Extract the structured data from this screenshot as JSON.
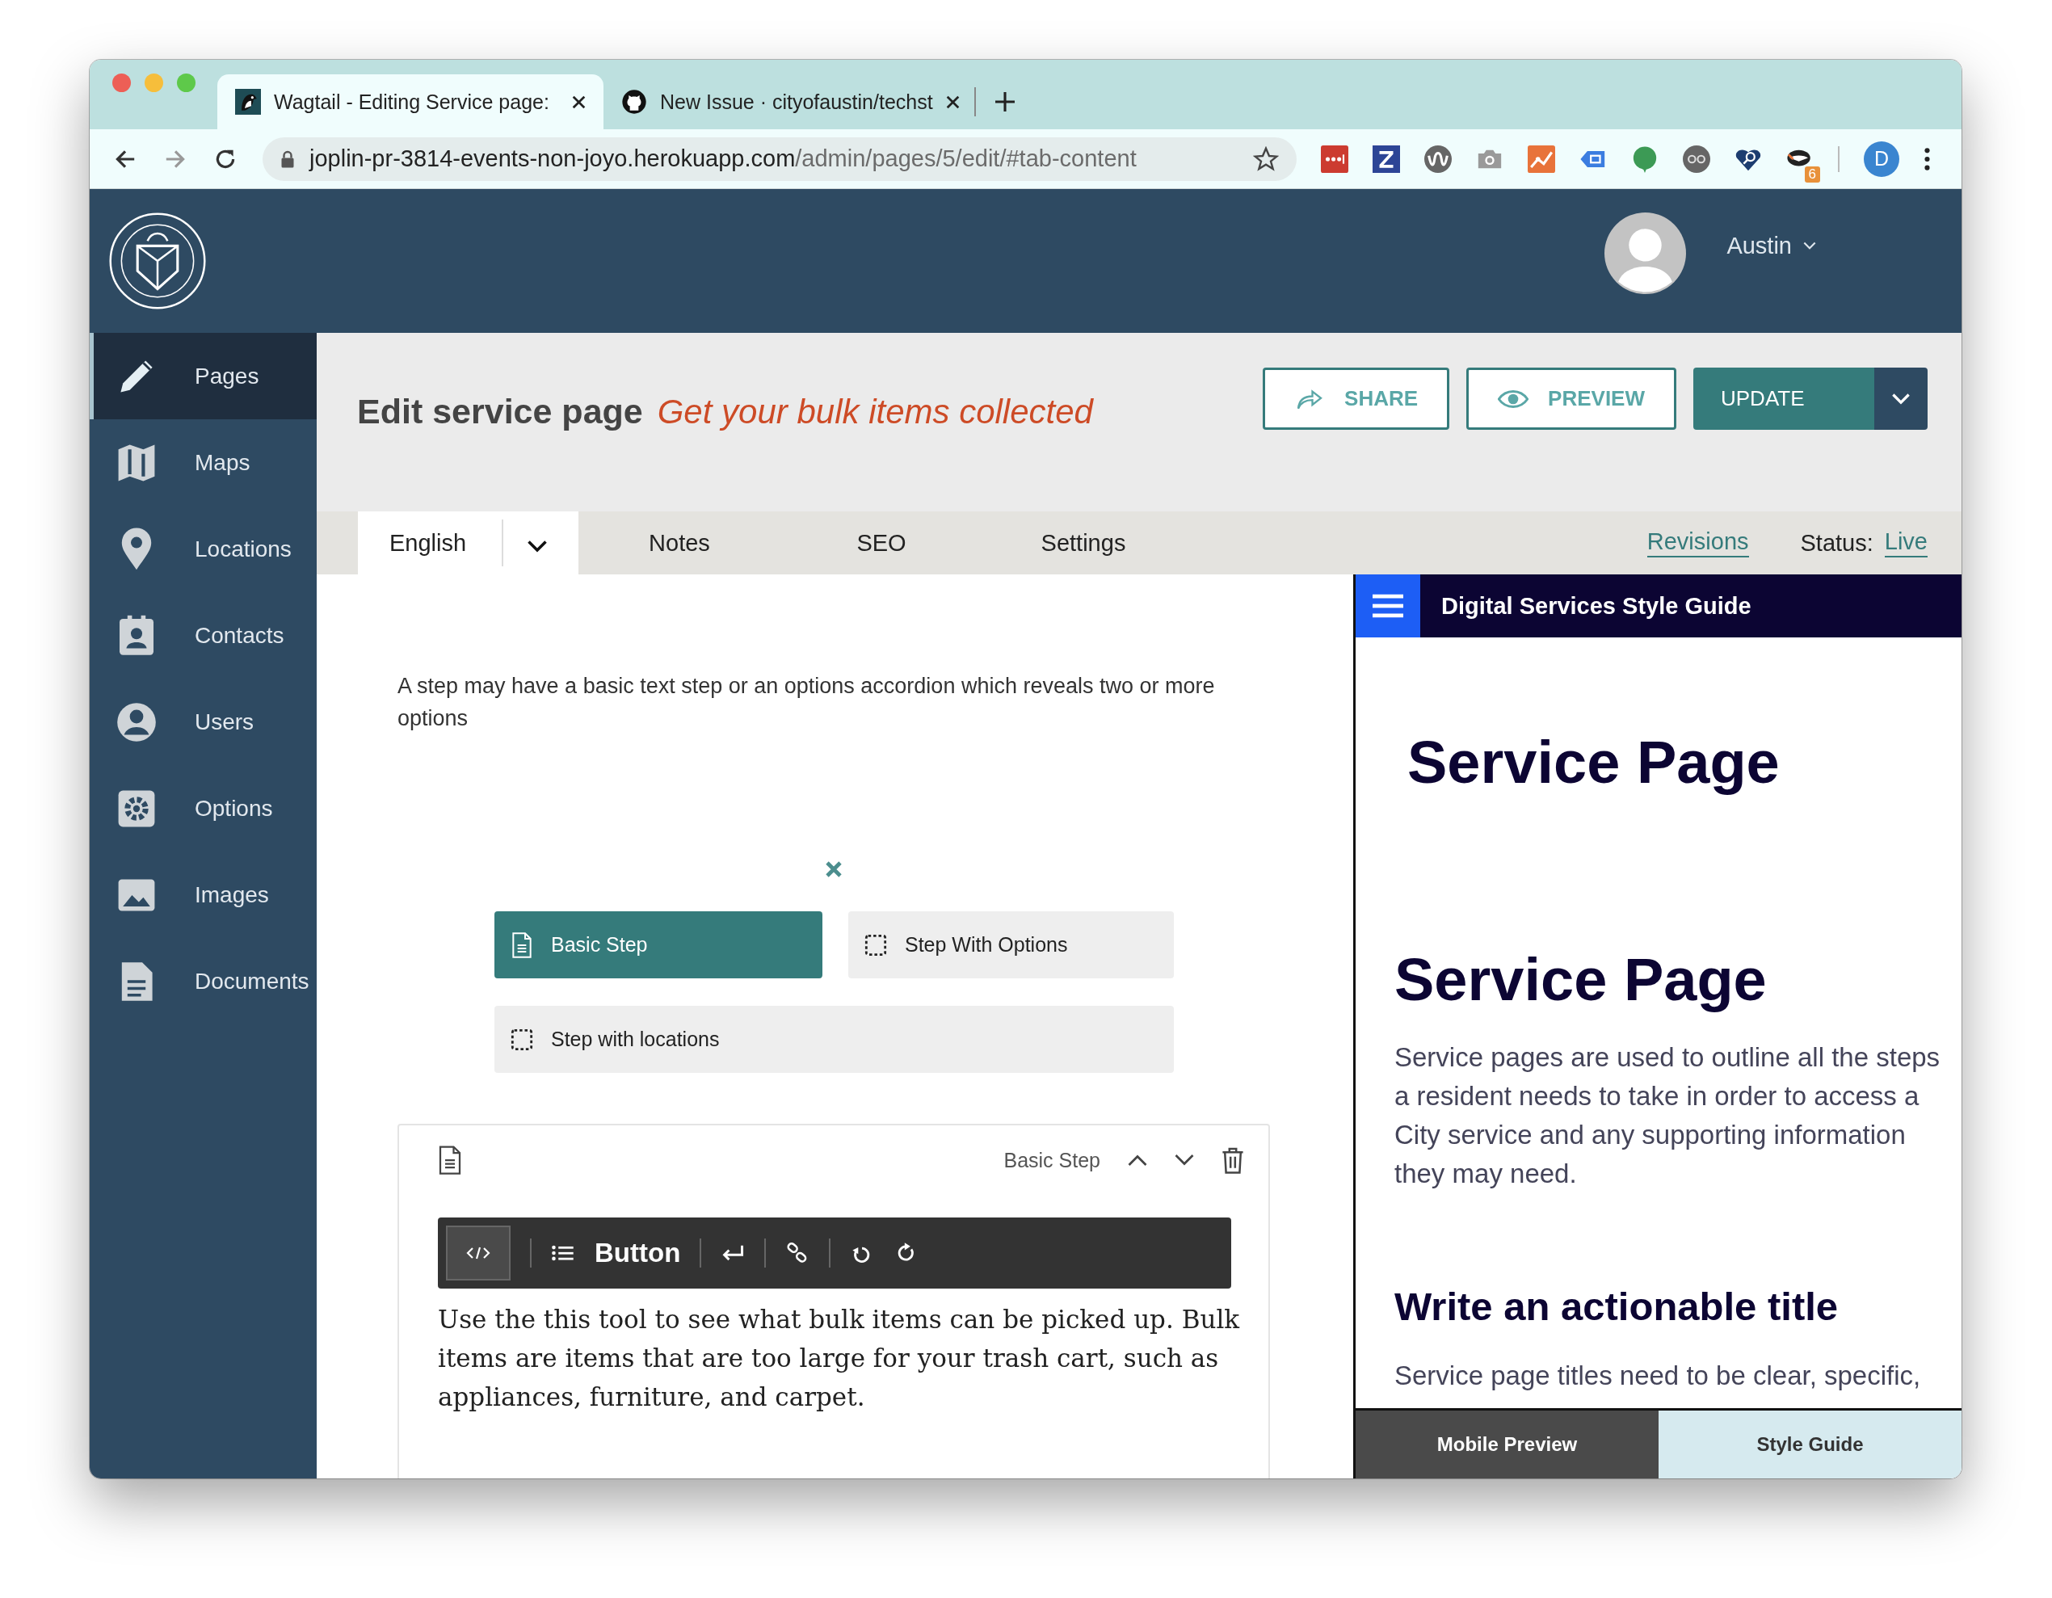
{
  "browser": {
    "tabs": [
      {
        "title": "Wagtail - Editing Service page:",
        "selected": true
      },
      {
        "title": "New Issue · cityofaustin/techst",
        "selected": false
      }
    ],
    "address": {
      "host": "joplin-pr-3814-events-non-joyo.herokuapp.com",
      "path": "/admin/pages/5/edit/#tab-content"
    },
    "extension_badge": "6",
    "profile_initial": "D"
  },
  "header": {
    "user_name": "Austin"
  },
  "sidebar": {
    "items": [
      {
        "label": "Pages",
        "selected": true
      },
      {
        "label": "Maps",
        "selected": false
      },
      {
        "label": "Locations",
        "selected": false
      },
      {
        "label": "Contacts",
        "selected": false
      },
      {
        "label": "Users",
        "selected": false
      },
      {
        "label": "Options",
        "selected": false
      },
      {
        "label": "Images",
        "selected": false
      },
      {
        "label": "Documents",
        "selected": false
      }
    ]
  },
  "page_header": {
    "title": "Edit service page",
    "subtitle": "Get your bulk items collected",
    "actions": [
      "SHARE",
      "PREVIEW",
      "UPDATE"
    ]
  },
  "tabs": [
    {
      "label": "English",
      "selected": true
    },
    {
      "label": "Notes",
      "selected": false
    },
    {
      "label": "SEO",
      "selected": false
    },
    {
      "label": "Settings",
      "selected": false
    }
  ],
  "revisions_link": "Revisions",
  "status": {
    "label": "Status:",
    "value": "Live"
  },
  "editor": {
    "help_text": "A step may have a basic text step or an options accordion which reveals two or more options",
    "block_choices": [
      {
        "label": "Basic Step",
        "selected": true
      },
      {
        "label": "Step With Options",
        "selected": false
      },
      {
        "label": "Step with locations",
        "selected": false
      }
    ],
    "block": {
      "type_label": "Basic Step",
      "toolbar_label": "Button",
      "text": "Use the this tool to see what bulk items can be picked up. Bulk items are items that are too large for your trash cart, such as appliances, furniture, and carpet."
    }
  },
  "preview": {
    "site_title": "Digital Services Style Guide",
    "heading_1": "Service Page",
    "heading_2": "Service Page",
    "intro": "Service pages are used to outline all the steps a resident needs to take in order to access a City service and any supporting information they may need.",
    "section_heading": "Write an actionable title",
    "section_text": "Service page titles need to be clear, specific,",
    "tabs": [
      {
        "label": "Mobile Preview",
        "selected": false
      },
      {
        "label": "Style Guide",
        "selected": true
      }
    ]
  }
}
